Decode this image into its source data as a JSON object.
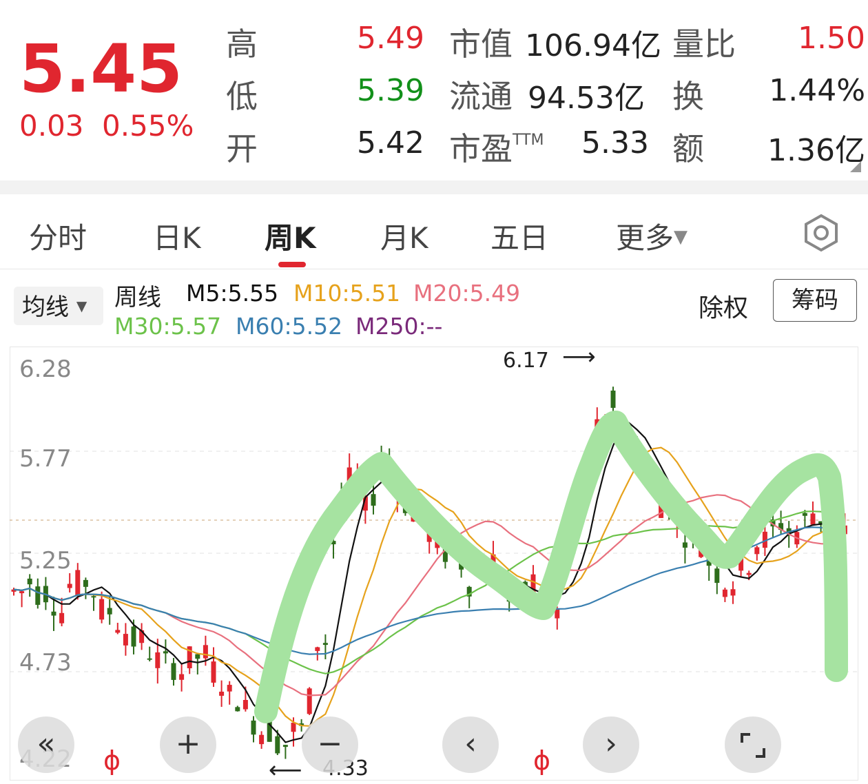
{
  "quote": {
    "price": "5.45",
    "change": "0.03",
    "change_pct": "0.55%",
    "fields": [
      {
        "label": "高",
        "value": "5.49",
        "color": "#e0262f"
      },
      {
        "label": "低",
        "value": "5.39",
        "color": "#12901a"
      },
      {
        "label": "开",
        "value": "5.42",
        "color": "#222222"
      }
    ],
    "mid": [
      {
        "label": "市值",
        "value": "106.94亿"
      },
      {
        "label": "流通",
        "value": "94.53亿"
      },
      {
        "label": "市盈",
        "sup": "TTM",
        "value": "5.33"
      }
    ],
    "right": [
      {
        "label": "量比",
        "value": "1.50",
        "color": "#e0262f"
      },
      {
        "label": "换",
        "value": "1.44%",
        "color": "#222222"
      },
      {
        "label": "额",
        "value": "1.36亿",
        "color": "#222222"
      }
    ]
  },
  "tabs": [
    {
      "label": "分时"
    },
    {
      "label": "日K"
    },
    {
      "label": "周K",
      "active": true
    },
    {
      "label": "月K"
    },
    {
      "label": "五日"
    },
    {
      "label": "更多"
    }
  ],
  "indicator": {
    "ma_button": "均线",
    "period": "周线",
    "ma": [
      {
        "label": "M5:5.55",
        "color": "#111111"
      },
      {
        "label": "M10:5.51",
        "color": "#e6a21c"
      },
      {
        "label": "M20:5.49",
        "color": "#e8707e"
      },
      {
        "label": "M30:5.57",
        "color": "#6cc24a"
      },
      {
        "label": "M60:5.52",
        "color": "#3a7fb0"
      },
      {
        "label": "M250:--",
        "color": "#7a2a7a"
      }
    ],
    "exrights": "除权",
    "chips": "筹码"
  },
  "chart": {
    "y_labels": [
      "6.28",
      "5.77",
      "5.25",
      "4.73",
      "4.22"
    ],
    "high_label": "6.17",
    "low_label": "4.33",
    "colors": {
      "up": "#e0262f",
      "down": "#2e6d1c",
      "highlight": "#a6e3a1"
    }
  },
  "controls": {
    "icons": [
      "double-left-icon",
      "zoom-in-icon",
      "zoom-out-icon",
      "prev-icon",
      "next-icon",
      "fullscreen-icon",
      "gear-icon"
    ]
  }
}
